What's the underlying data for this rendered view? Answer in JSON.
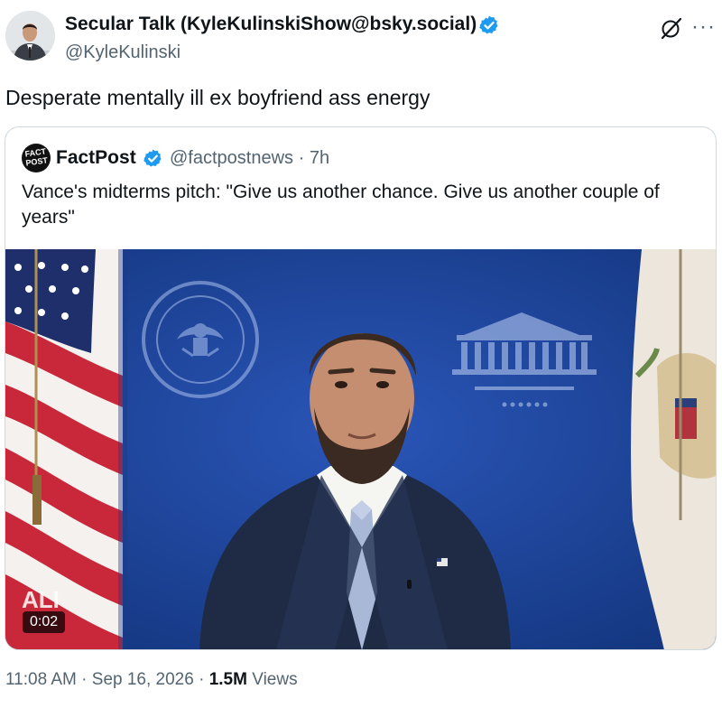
{
  "author": {
    "name": "Secular Talk (KyleKulinskiShow@bsky.social)",
    "handle": "@KyleKulinski"
  },
  "tweet": {
    "text": "Desperate mentally ill ex boyfriend ass energy"
  },
  "quoted": {
    "avatar_text": "FACT POST",
    "name": "FactPost",
    "handle": "@factpostnews",
    "separator": "·",
    "age": "7h",
    "text": "Vance's midterms pitch: \"Give us another chance. Give us another couple of years\"",
    "video": {
      "duration": "0:02",
      "overlay_text": "ALI"
    }
  },
  "footer": {
    "time": "11:08 AM",
    "separator": "·",
    "date": "Sep 16, 2026",
    "views_count": "1.5M",
    "views_label": "Views"
  },
  "icons": {
    "verified": "verified-badge-icon",
    "grok": "grok-icon",
    "more": "more-icon"
  },
  "colors": {
    "verified": "#1d9bf0",
    "secondary_text": "#536471",
    "border": "#cfd9de",
    "backdrop_blue": "#1a3f93"
  }
}
